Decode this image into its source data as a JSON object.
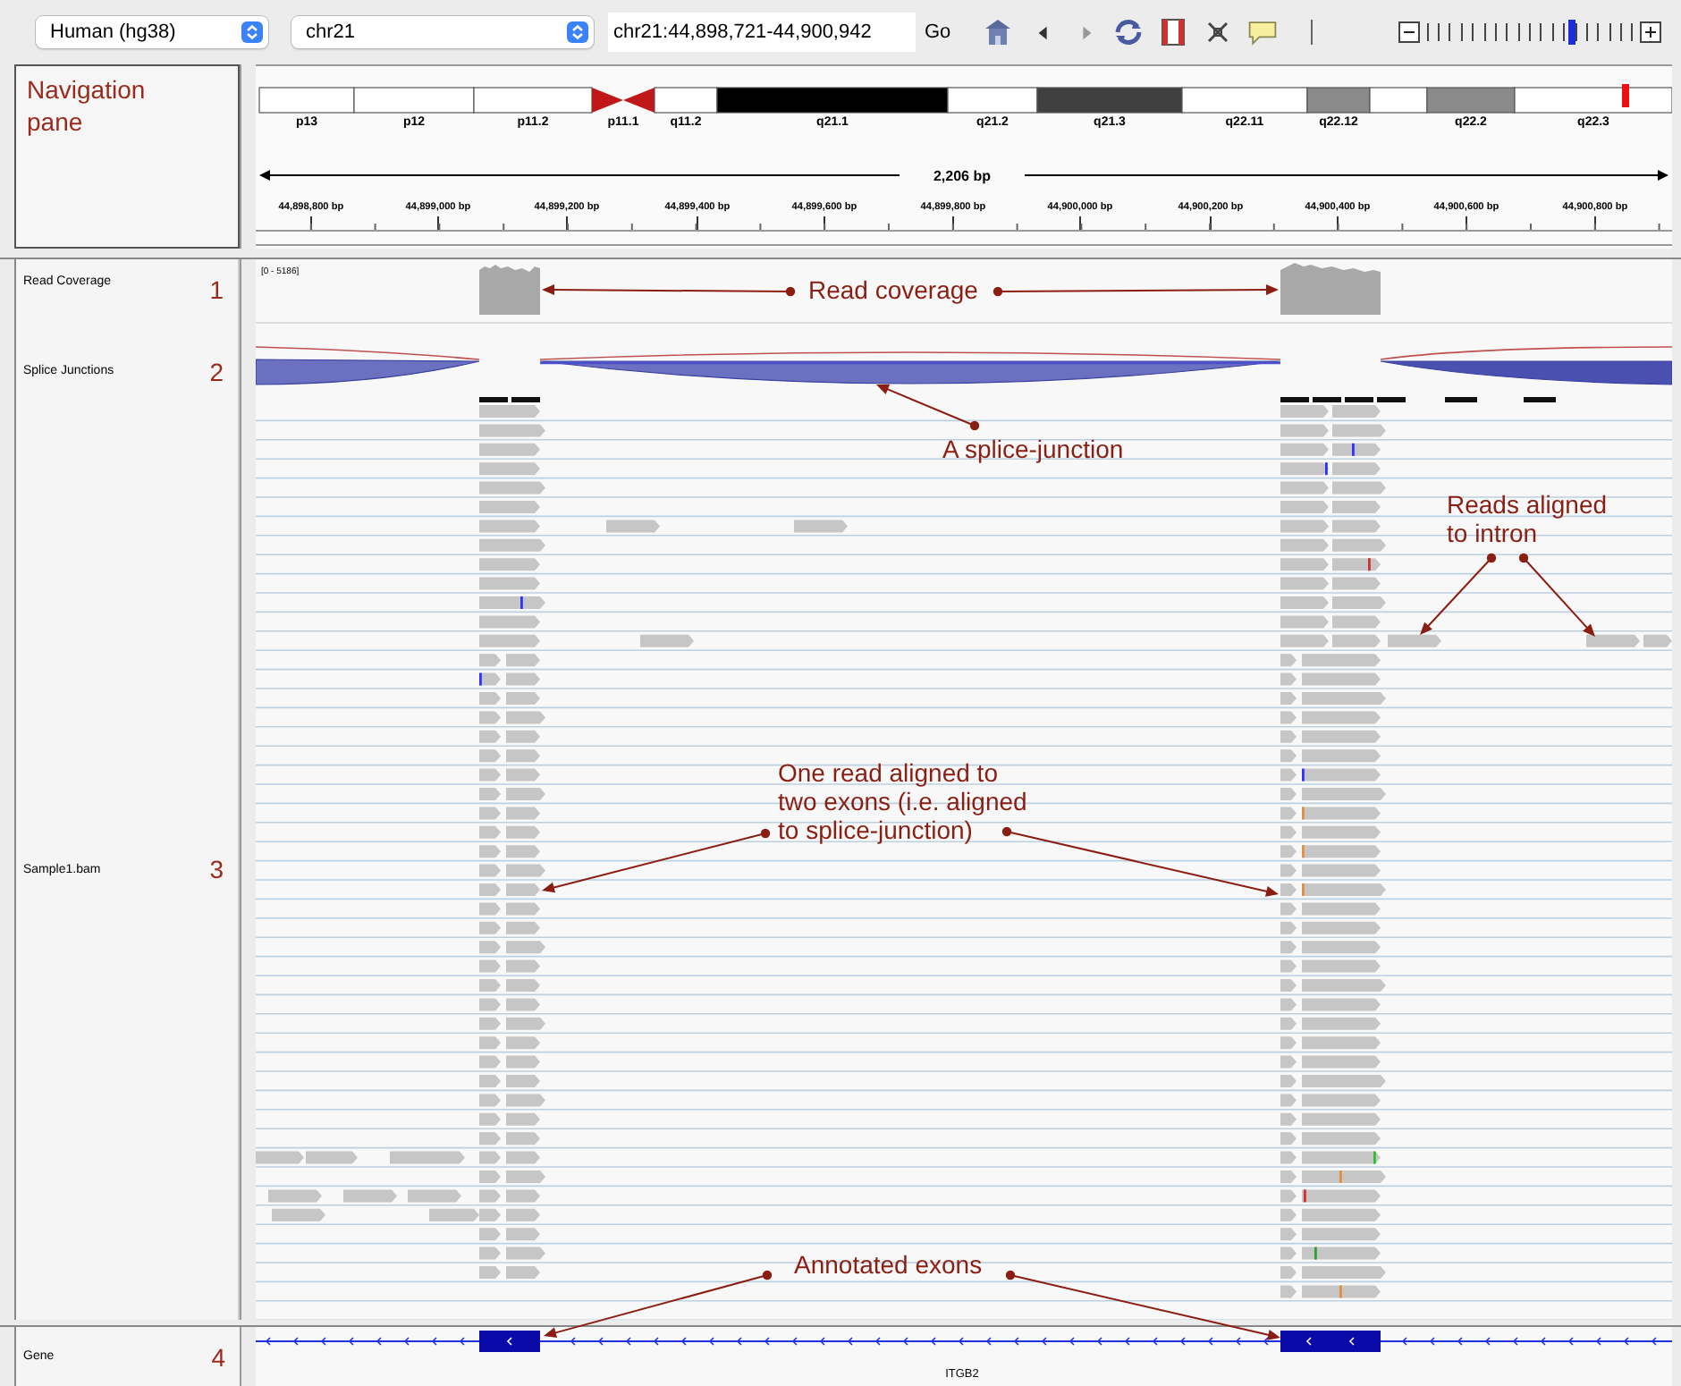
{
  "toolbar": {
    "genome": "Human (hg38)",
    "chromosome": "chr21",
    "locus": "chr21:44,898,721-44,900,942",
    "go_button": "Go",
    "zoom": {
      "level": 0.7
    }
  },
  "navigation": {
    "label": "Navigation pane",
    "ideogram": [
      {
        "label": "p13",
        "kind": "gneg"
      },
      {
        "label": "p12",
        "kind": "gneg"
      },
      {
        "label": "p11.2",
        "kind": "gneg"
      },
      {
        "label": "p11.1",
        "kind": "acen"
      },
      {
        "label": "q11.2",
        "kind": "gneg"
      },
      {
        "label": "q21.1",
        "kind": "gpos100"
      },
      {
        "label": "q21.2",
        "kind": "gneg"
      },
      {
        "label": "q21.3",
        "kind": "gpos75"
      },
      {
        "label": "q22.11",
        "kind": "gneg"
      },
      {
        "label": "q22.12",
        "kind": "gpos50"
      },
      {
        "kind": "gneg"
      },
      {
        "label": "q22.2",
        "kind": "gpos50"
      },
      {
        "label": "q22.3",
        "kind": "gneg"
      }
    ],
    "span": "2,206 bp",
    "ruler_ticks": [
      "44,898,800 bp",
      "44,899,000 bp",
      "44,899,200 bp",
      "44,899,400 bp",
      "44,899,600 bp",
      "44,899,800 bp",
      "44,900,000 bp",
      "44,900,200 bp",
      "44,900,400 bp",
      "44,900,600 bp",
      "44,900,800 bp"
    ]
  },
  "tracks": [
    {
      "kind": "coverage",
      "name": "Read Coverage",
      "number": "1",
      "range": "[0 - 5186]"
    },
    {
      "kind": "junctions",
      "name": "Splice Junctions",
      "number": "2"
    },
    {
      "kind": "alignments",
      "name": "Sample1.bam",
      "number": "3"
    }
  ],
  "gene_track": {
    "name": "Gene",
    "number": "4",
    "gene": "ITGB2"
  },
  "annotations": [
    {
      "text": "Read coverage"
    },
    {
      "text": "A splice-junction"
    },
    {
      "text": "Reads aligned\nto intron"
    },
    {
      "text": "One read aligned to\ntwo exons (i.e. aligned\nto splice-junction)"
    },
    {
      "text": "Annotated exons"
    }
  ]
}
